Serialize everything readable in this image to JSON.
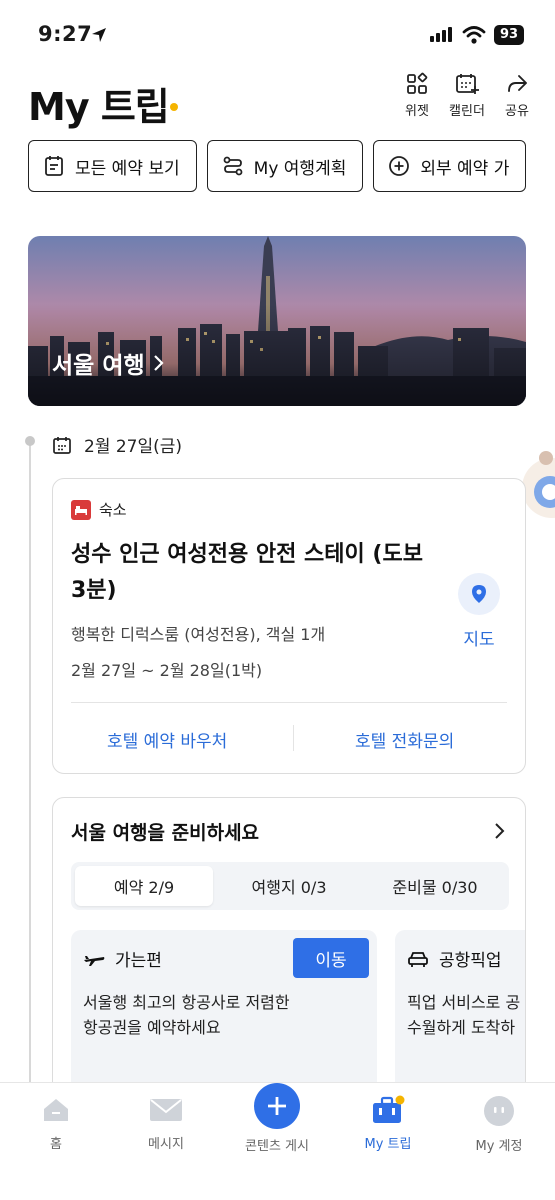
{
  "status_bar": {
    "time": "9:27",
    "battery": "93"
  },
  "header": {
    "title": "My 트립",
    "actions": [
      {
        "label": "위젯",
        "icon": "widget-icon"
      },
      {
        "label": "캘린더",
        "icon": "calendar-add-icon"
      },
      {
        "label": "공유",
        "icon": "share-icon"
      }
    ]
  },
  "chips": [
    {
      "label": "모든 예약 보기",
      "icon": "clipboard-icon"
    },
    {
      "label": "My 여행계획",
      "icon": "route-icon"
    },
    {
      "label": "외부 예약 가",
      "icon": "plus-circle-icon"
    }
  ],
  "banner": {
    "label": "서울 여행"
  },
  "timeline": {
    "date": "2월 27일(금)"
  },
  "accommodation": {
    "category": "숙소",
    "name": "성수 인근 여성전용 안전 스테이 (도보 3분)",
    "room": "행복한 디럭스룸 (여성전용), 객실 1개",
    "dates": "2월 27일 ~ 2월 28일(1박)",
    "map_label": "지도",
    "voucher_label": "호텔 예약 바우처",
    "phone_label": "호텔 전화문의"
  },
  "prepare": {
    "title": "서울 여행을 준비하세요",
    "tabs": [
      {
        "label": "예약 2/9",
        "active": true
      },
      {
        "label": "여행지 0/3",
        "active": false
      },
      {
        "label": "준비물 0/30",
        "active": false
      }
    ],
    "cards": [
      {
        "title": "가는편",
        "icon": "airplane-icon",
        "desc": "서울행 최고의 항공사로 저렴한\n항공권을 예약하세요",
        "button": "이동"
      },
      {
        "title": "공항픽업",
        "icon": "car-icon",
        "desc": "픽업 서비스로 공\n수월하게 도착하"
      }
    ]
  },
  "bottom_nav": [
    {
      "label": "홈",
      "icon": "home-icon",
      "active": false
    },
    {
      "label": "메시지",
      "icon": "mail-icon",
      "active": false
    },
    {
      "label": "콘텐츠 게시",
      "icon": "plus-icon",
      "active": false
    },
    {
      "label": "My 트립",
      "icon": "suitcase-icon",
      "active": true
    },
    {
      "label": "My 계정",
      "icon": "profile-icon",
      "active": false
    }
  ],
  "colors": {
    "accent": "#2f6fe6",
    "link": "#2b6cd8",
    "title_dot": "#f5b400",
    "category_red": "#d93a3a"
  }
}
